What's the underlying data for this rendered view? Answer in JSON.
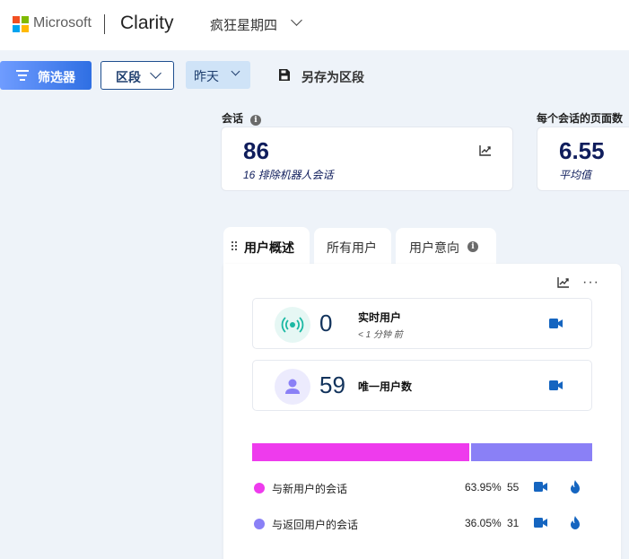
{
  "header": {
    "brand": "Microsoft",
    "product": "Clarity",
    "project": "疯狂星期四",
    "logo_colors": [
      "#f25022",
      "#7fba00",
      "#00a4ef",
      "#ffb900"
    ]
  },
  "toolbar": {
    "filter_label": "筛选器",
    "segment_label": "区段",
    "date_label": "昨天",
    "save_label": "另存为区段"
  },
  "metrics": {
    "sessions": {
      "title": "会话",
      "value": "86",
      "sub": "16 排除机器人会话"
    },
    "pages_per_session": {
      "title": "每个会话的页面数",
      "value": "6.55",
      "sub": "平均值"
    }
  },
  "tabs": [
    {
      "label": "用户概述",
      "active": true
    },
    {
      "label": "所有用户",
      "active": false
    },
    {
      "label": "用户意向",
      "active": false
    }
  ],
  "overview": {
    "more_label": "···",
    "live": {
      "value": "0",
      "label": "实时用户",
      "sub": "< 1 分钟 前"
    },
    "unique": {
      "value": "59",
      "label": "唯一用户数"
    },
    "breakdown": [
      {
        "label": "与新用户的会话",
        "percent": "63.95%",
        "count": "55",
        "fraction": 0.6395,
        "color": "#ee3bed"
      },
      {
        "label": "与返回用户的会话",
        "percent": "36.05%",
        "count": "31",
        "fraction": 0.3605,
        "color": "#8a80f6"
      }
    ]
  },
  "colors": {
    "accent_blue": "#1565c0",
    "live_teal": "#1ab8a3",
    "live_bg": "#e6f7f4",
    "user_icon": "#8a80f6",
    "user_bg": "#ecebfd"
  }
}
